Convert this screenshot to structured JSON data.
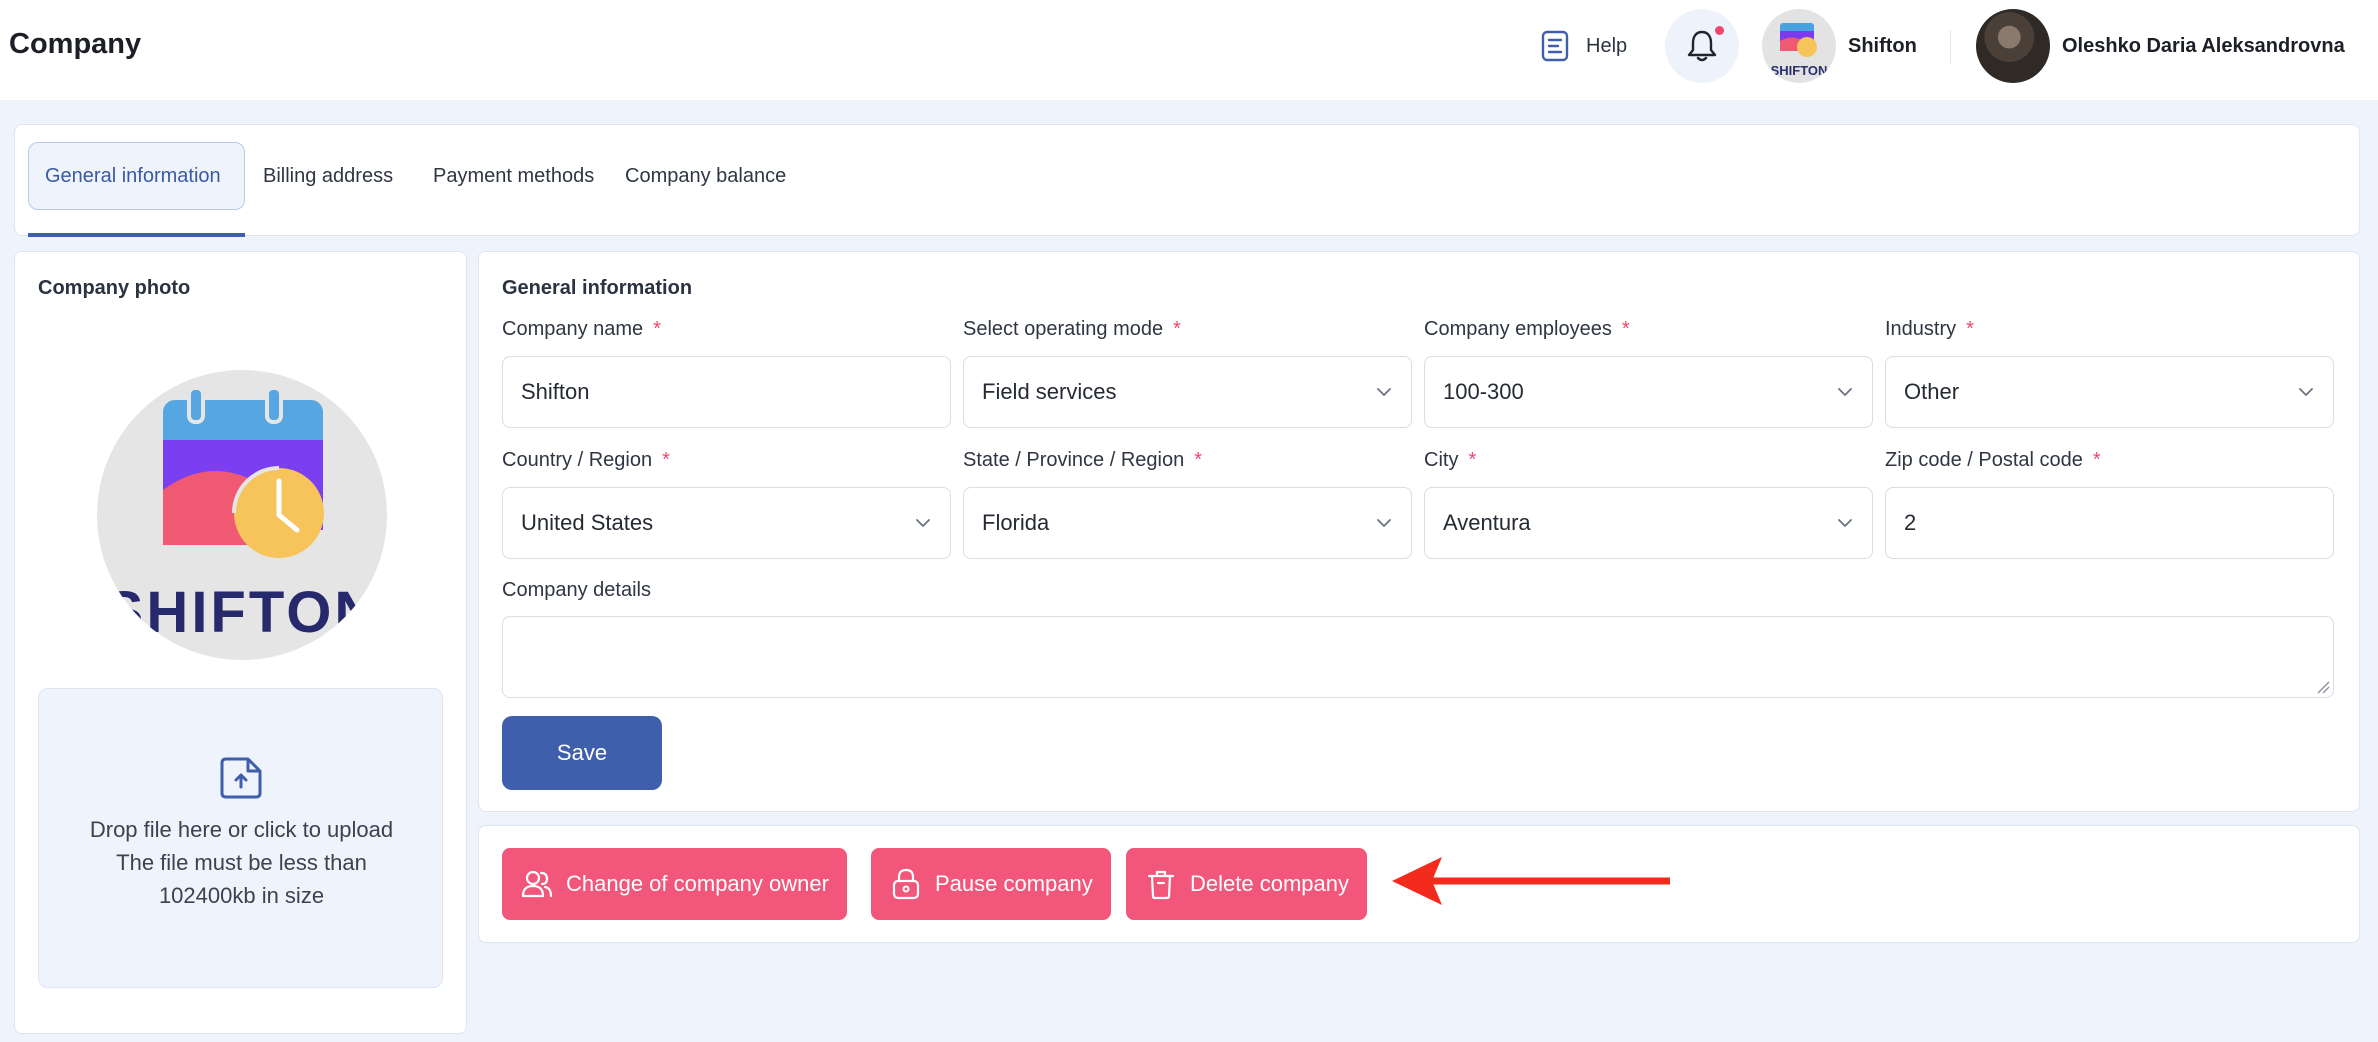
{
  "header": {
    "title": "Company",
    "help_label": "Help",
    "company_name": "Shifton",
    "user_name": "Oleshko Daria Aleksandrovna"
  },
  "tabs": [
    {
      "label": "General information",
      "active": true
    },
    {
      "label": "Billing address",
      "active": false
    },
    {
      "label": "Payment methods",
      "active": false
    },
    {
      "label": "Company balance",
      "active": false
    }
  ],
  "photo": {
    "title": "Company photo",
    "logo_text": "SHIFTON",
    "upload_line1": "Drop file here or click to upload",
    "upload_line2": "The file must be less than",
    "upload_line3": "102400kb in size"
  },
  "form": {
    "title": "General information",
    "fields": [
      {
        "label": "Company name",
        "value": "Shifton",
        "type": "text"
      },
      {
        "label": "Select operating mode",
        "value": "Field services",
        "type": "select"
      },
      {
        "label": "Company employees",
        "value": "100-300",
        "type": "select"
      },
      {
        "label": "Industry",
        "value": "Other",
        "type": "select"
      },
      {
        "label": "Country / Region",
        "value": "United States",
        "type": "select"
      },
      {
        "label": "State / Province / Region",
        "value": "Florida",
        "type": "select"
      },
      {
        "label": "City",
        "value": "Aventura",
        "type": "select"
      },
      {
        "label": "Zip code / Postal code",
        "value": "2",
        "type": "text"
      }
    ],
    "required_mark": "*",
    "details_label": "Company details",
    "details_value": "",
    "save_label": "Save"
  },
  "actions": {
    "change_owner_label": "Change of company owner",
    "pause_label": "Pause company",
    "delete_label": "Delete company"
  },
  "colors": {
    "accent": "#3f5fad",
    "danger": "#f2567a",
    "annotation_arrow": "#f22b1c"
  }
}
